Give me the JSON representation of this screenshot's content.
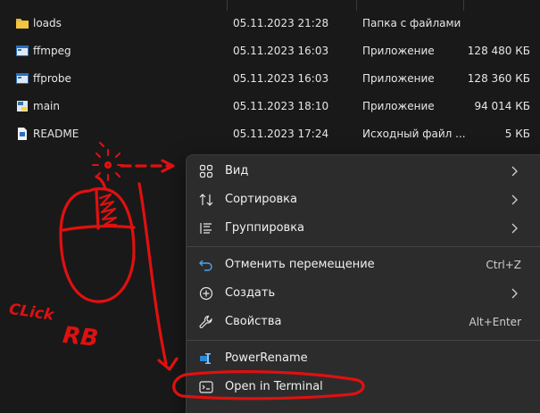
{
  "files": [
    {
      "name": "loads",
      "date": "05.11.2023 21:28",
      "type": "Папка с файлами",
      "size": "",
      "icon": "folder-icon"
    },
    {
      "name": "ffmpeg",
      "date": "05.11.2023 16:03",
      "type": "Приложение",
      "size": "128 480 КБ",
      "icon": "exe-icon"
    },
    {
      "name": "ffprobe",
      "date": "05.11.2023 16:03",
      "type": "Приложение",
      "size": "128 360 КБ",
      "icon": "exe-icon"
    },
    {
      "name": "main",
      "date": "05.11.2023 18:10",
      "type": "Приложение",
      "size": "94 014 КБ",
      "icon": "python-exe-icon"
    },
    {
      "name": "README",
      "date": "05.11.2023 17:24",
      "type": "Исходный файл ...",
      "size": "5 КБ",
      "icon": "document-icon"
    }
  ],
  "context_menu": {
    "view": {
      "label": "Вид",
      "icon": "grid-icon"
    },
    "sort": {
      "label": "Сортировка",
      "icon": "sort-arrows-icon"
    },
    "group": {
      "label": "Группировка",
      "icon": "group-list-icon"
    },
    "undo": {
      "label": "Отменить перемещение",
      "shortcut": "Ctrl+Z",
      "icon": "undo-icon"
    },
    "create": {
      "label": "Создать",
      "icon": "plus-circle-icon"
    },
    "properties": {
      "label": "Свойства",
      "shortcut": "Alt+Enter",
      "icon": "wrench-icon"
    },
    "powerrename": {
      "label": "PowerRename",
      "icon": "powerrename-icon"
    },
    "terminal": {
      "label": "Open in Terminal",
      "icon": "terminal-icon"
    }
  },
  "annotation": {
    "text_click": "CLick",
    "text_rb": "RB",
    "color": "#e01010"
  },
  "colors": {
    "background": "#191919",
    "menu": "#2c2c2c",
    "accent": "#0078d4",
    "folder": "#f4c542"
  }
}
